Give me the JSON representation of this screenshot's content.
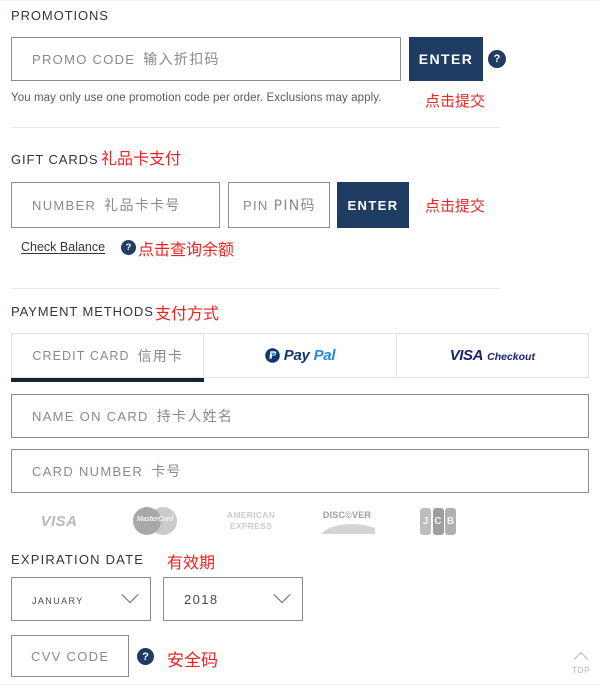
{
  "promotions": {
    "section_label": "PROMOTIONS",
    "promo_input": {
      "placeholder": "PROMO CODE",
      "value": "",
      "annotation": "输入折扣码"
    },
    "enter_button": "ENTER",
    "enter_annotation": "点击提交",
    "help_icon_label": "?",
    "helper_text": "You may only use one promotion code per order. Exclusions may apply."
  },
  "gift_cards": {
    "section_label": "GIFT CARDS",
    "section_annotation": "礼品卡支付",
    "number_input": {
      "placeholder": "NUMBER",
      "value": "",
      "annotation": "礼品卡卡号"
    },
    "pin_input": {
      "placeholder": "PIN",
      "value": "",
      "annotation": "PIN码"
    },
    "enter_button": "ENTER",
    "enter_annotation": "点击提交",
    "check_balance_link": "Check Balance",
    "check_balance_help_icon": "?",
    "check_balance_annotation": "点击查询余额"
  },
  "payment_methods": {
    "section_label": "PAYMENT METHODS",
    "section_annotation": "支付方式",
    "tabs": [
      {
        "id": "credit-card",
        "label": "CREDIT CARD",
        "annotation": "信用卡",
        "active": true
      },
      {
        "id": "paypal",
        "logo": "paypal-logo",
        "paypal_dark": "Pay",
        "paypal_light": "Pal",
        "active": false
      },
      {
        "id": "visa-checkout",
        "logo": "visa-checkout-logo",
        "visa_word": "VISA",
        "checkout_word": "Checkout",
        "active": false
      }
    ],
    "name_on_card": {
      "placeholder": "NAME ON CARD",
      "value": "",
      "annotation": "持卡人姓名"
    },
    "card_number": {
      "placeholder": "CARD NUMBER",
      "value": "",
      "annotation": "卡号"
    },
    "accepted_brands": [
      {
        "id": "visa",
        "label": "VISA"
      },
      {
        "id": "mastercard",
        "label": "MasterCard"
      },
      {
        "id": "amex",
        "line1": "AMERICAN",
        "line2": "EXPRESS"
      },
      {
        "id": "discover",
        "label": "DISC©VER"
      },
      {
        "id": "jcb",
        "letters": [
          "J",
          "C",
          "B"
        ]
      }
    ],
    "expiration": {
      "label": "EXPIRATION DATE",
      "annotation": "有效期",
      "month_value": "January",
      "year_value": "2018"
    },
    "cvv": {
      "placeholder": "CVV CODE",
      "value": "",
      "help_icon": "?",
      "annotation": "安全码"
    }
  },
  "scroll_top": {
    "label": "TOP"
  },
  "colors": {
    "navy": "#1f3c63",
    "tab_underline": "#142538",
    "annotation_red": "#ee2222",
    "field_border": "#8c8c8c",
    "divider": "#e6e6e6"
  }
}
